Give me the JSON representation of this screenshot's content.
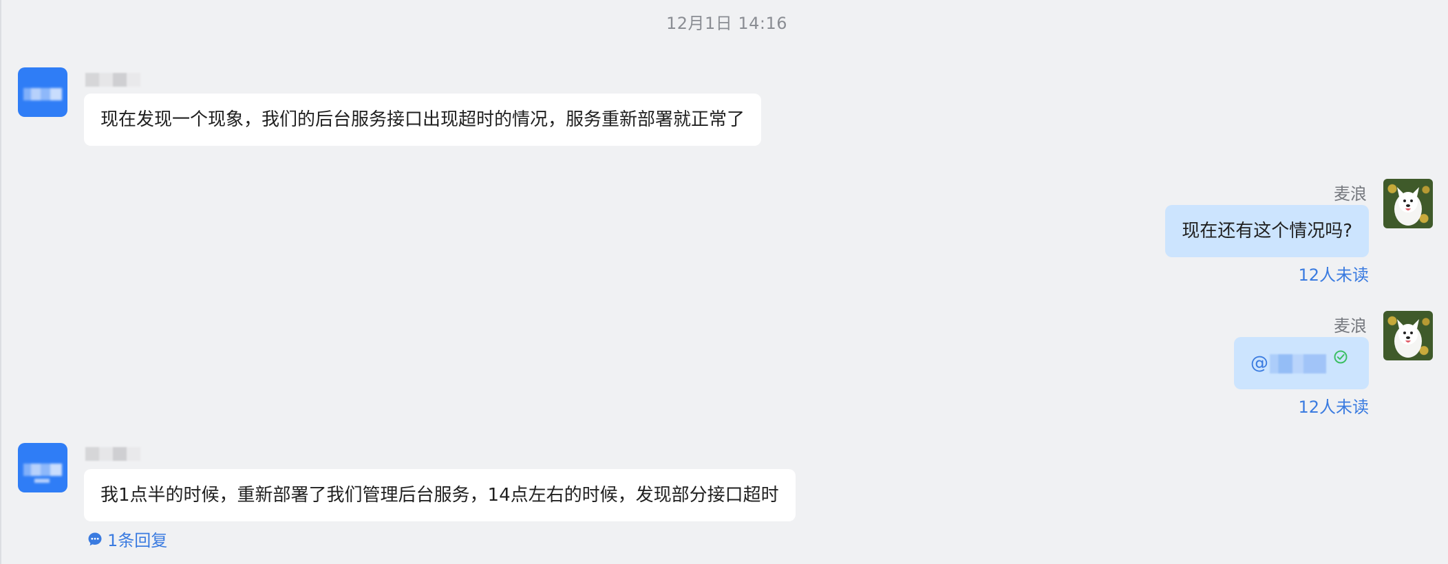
{
  "timestamp": "12月1日 14:16",
  "messages": [
    {
      "side": "left",
      "text": "现在发现一个现象，我们的后台服务接口出现超时的情况，服务重新部署就正常了"
    },
    {
      "side": "right",
      "sender": "麦浪",
      "text": "现在还有这个情况吗?",
      "status": "12人未读"
    },
    {
      "side": "right",
      "sender": "麦浪",
      "mention_prefix": "@",
      "status": "12人未读"
    },
    {
      "side": "left",
      "text": "我1点半的时候，重新部署了我们管理后台服务，14点左右的时候，发现部分接口超时",
      "reply_label": "1条回复"
    }
  ],
  "colors": {
    "background": "#f0f1f3",
    "self_bubble": "#cce4fe",
    "other_bubble": "#ffffff",
    "link": "#3a7be0",
    "avatar_blue": "#2f7df6",
    "check": "#3bbf63"
  },
  "icons": {
    "reply": "chat-bubble-icon",
    "delivered": "check-circle-icon"
  }
}
